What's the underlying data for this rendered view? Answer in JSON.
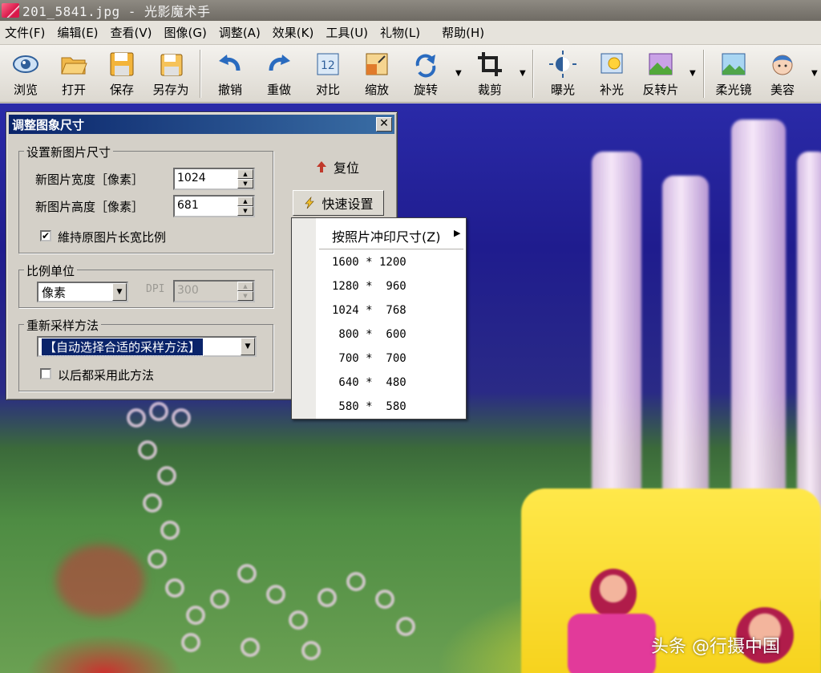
{
  "window": {
    "title": "201_5841.jpg - 光影魔术手"
  },
  "menu": [
    "文件(F)",
    "编辑(E)",
    "查看(V)",
    "图像(G)",
    "调整(A)",
    "效果(K)",
    "工具(U)",
    "礼物(L)",
    "帮助(H)"
  ],
  "toolbar": [
    {
      "label": "浏览",
      "icon": "eye-icon"
    },
    {
      "label": "打开",
      "icon": "folder-open-icon"
    },
    {
      "label": "保存",
      "icon": "floppy-disk-icon"
    },
    {
      "label": "另存为",
      "icon": "save-as-icon"
    },
    {
      "label": "撤销",
      "icon": "undo-icon"
    },
    {
      "label": "重做",
      "icon": "redo-icon"
    },
    {
      "label": "对比",
      "icon": "compare-icon"
    },
    {
      "label": "缩放",
      "icon": "resize-icon"
    },
    {
      "label": "旋转",
      "icon": "rotate-icon"
    },
    {
      "label": "裁剪",
      "icon": "crop-icon"
    },
    {
      "label": "曝光",
      "icon": "exposure-icon"
    },
    {
      "label": "补光",
      "icon": "fill-light-icon"
    },
    {
      "label": "反转片",
      "icon": "reversal-film-icon"
    },
    {
      "label": "柔光镜",
      "icon": "soft-focus-icon"
    },
    {
      "label": "美容",
      "icon": "beauty-face-icon"
    }
  ],
  "dialog": {
    "title": "调整图象尺寸",
    "close": "✕",
    "size_group": {
      "title": "设置新图片尺寸",
      "width_label": "新图片宽度［像素］",
      "width_value": "1024",
      "height_label": "新图片高度［像素］",
      "height_value": "681",
      "keep_ratio_label": "維持原图片长宽比例",
      "keep_ratio_checked": true
    },
    "unit_group": {
      "title": "比例单位",
      "unit_value": "像素",
      "dpi_label": "DPI",
      "dpi_value": "300"
    },
    "resample_group": {
      "title": "重新采样方法",
      "method_value": "【自动选择合适的采样方法】",
      "always_label": "以后都采用此方法",
      "always_checked": false
    },
    "reset_label": "复位",
    "quick_label": "快速设置"
  },
  "popup": {
    "header": "按照片冲印尺寸(Z)",
    "items": [
      "1600 * 1200",
      "1280 *  960",
      "1024 *  768",
      " 800 *  600",
      " 700 *  700",
      " 640 *  480",
      " 580 *  580"
    ]
  },
  "watermark": "头条 @行摄中国"
}
